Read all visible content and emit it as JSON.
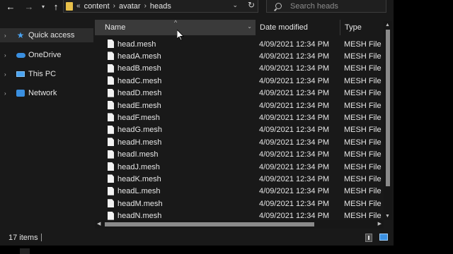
{
  "address": {
    "prefix": "«",
    "crumbs": [
      "content",
      "avatar",
      "heads"
    ]
  },
  "search": {
    "placeholder": "Search heads"
  },
  "nav": {
    "items": [
      {
        "label": "Quick access",
        "icon": "star-icon"
      },
      {
        "label": "OneDrive",
        "icon": "cloud-icon"
      },
      {
        "label": "This PC",
        "icon": "monitor-icon"
      },
      {
        "label": "Network",
        "icon": "network-icon"
      }
    ]
  },
  "columns": {
    "name": "Name",
    "date": "Date modified",
    "type": "Type"
  },
  "files": [
    {
      "name": "head.mesh",
      "date": "4/09/2021 12:34 PM",
      "type": "MESH File"
    },
    {
      "name": "headA.mesh",
      "date": "4/09/2021 12:34 PM",
      "type": "MESH File"
    },
    {
      "name": "headB.mesh",
      "date": "4/09/2021 12:34 PM",
      "type": "MESH File"
    },
    {
      "name": "headC.mesh",
      "date": "4/09/2021 12:34 PM",
      "type": "MESH File"
    },
    {
      "name": "headD.mesh",
      "date": "4/09/2021 12:34 PM",
      "type": "MESH File"
    },
    {
      "name": "headE.mesh",
      "date": "4/09/2021 12:34 PM",
      "type": "MESH File"
    },
    {
      "name": "headF.mesh",
      "date": "4/09/2021 12:34 PM",
      "type": "MESH File"
    },
    {
      "name": "headG.mesh",
      "date": "4/09/2021 12:34 PM",
      "type": "MESH File"
    },
    {
      "name": "headH.mesh",
      "date": "4/09/2021 12:34 PM",
      "type": "MESH File"
    },
    {
      "name": "headI.mesh",
      "date": "4/09/2021 12:34 PM",
      "type": "MESH File"
    },
    {
      "name": "headJ.mesh",
      "date": "4/09/2021 12:34 PM",
      "type": "MESH File"
    },
    {
      "name": "headK.mesh",
      "date": "4/09/2021 12:34 PM",
      "type": "MESH File"
    },
    {
      "name": "headL.mesh",
      "date": "4/09/2021 12:34 PM",
      "type": "MESH File"
    },
    {
      "name": "headM.mesh",
      "date": "4/09/2021 12:34 PM",
      "type": "MESH File"
    },
    {
      "name": "headN.mesh",
      "date": "4/09/2021 12:34 PM",
      "type": "MESH File"
    }
  ],
  "status": {
    "item_count": "17 items"
  },
  "colors": {
    "background": "#191919",
    "header_selected": "#3a3a3a",
    "folder": "#e8c04a",
    "accent": "#3a8fe0"
  }
}
